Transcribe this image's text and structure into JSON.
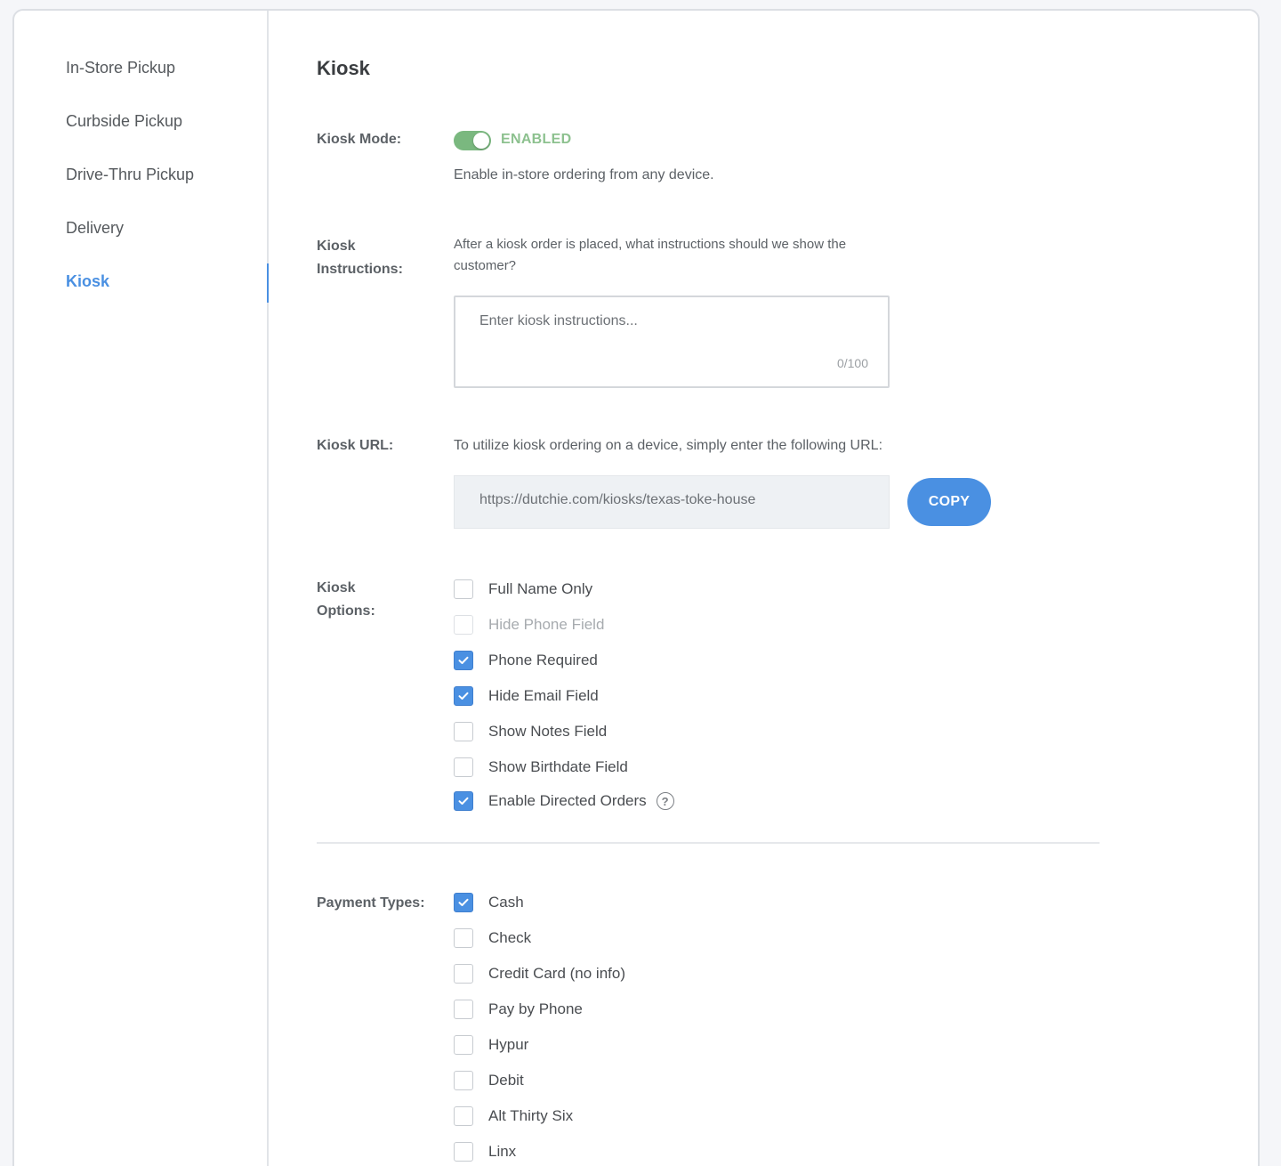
{
  "sidebar": {
    "items": [
      {
        "label": "In-Store Pickup"
      },
      {
        "label": "Curbside Pickup"
      },
      {
        "label": "Drive-Thru Pickup"
      },
      {
        "label": "Delivery"
      },
      {
        "label": "Kiosk",
        "active": true
      }
    ]
  },
  "page": {
    "title": "Kiosk"
  },
  "kiosk_mode": {
    "label": "Kiosk Mode:",
    "status": "ENABLED",
    "enabled": true,
    "description": "Enable in-store ordering from any device."
  },
  "kiosk_instructions": {
    "label_line1": "Kiosk",
    "label_line2": "Instructions:",
    "help": "After a kiosk order is placed, what instructions should we show the customer?",
    "placeholder": "Enter kiosk instructions...",
    "value": "",
    "char_count": "0/100"
  },
  "kiosk_url": {
    "label": "Kiosk URL:",
    "help": "To utilize kiosk ordering on a device, simply enter the following URL:",
    "url": "https://dutchie.com/kiosks/texas-toke-house",
    "copy_label": "COPY"
  },
  "kiosk_options": {
    "label_line1": "Kiosk",
    "label_line2": "Options:",
    "options": [
      {
        "label": "Full Name Only",
        "checked": false,
        "disabled": false
      },
      {
        "label": "Hide Phone Field",
        "checked": false,
        "disabled": true
      },
      {
        "label": "Phone Required",
        "checked": true,
        "disabled": false
      },
      {
        "label": "Hide Email Field",
        "checked": true,
        "disabled": false
      },
      {
        "label": "Show Notes Field",
        "checked": false,
        "disabled": false
      },
      {
        "label": "Show Birthdate Field",
        "checked": false,
        "disabled": false
      },
      {
        "label": "Enable Directed Orders",
        "checked": true,
        "disabled": false,
        "help_icon": "?"
      }
    ]
  },
  "payment_types": {
    "label": "Payment Types:",
    "options": [
      {
        "label": "Cash",
        "checked": true
      },
      {
        "label": "Check",
        "checked": false
      },
      {
        "label": "Credit Card (no info)",
        "checked": false
      },
      {
        "label": "Pay by Phone",
        "checked": false
      },
      {
        "label": "Hypur",
        "checked": false
      },
      {
        "label": "Debit",
        "checked": false
      },
      {
        "label": "Alt Thirty Six",
        "checked": false
      },
      {
        "label": "Linx",
        "checked": false
      }
    ]
  },
  "colors": {
    "accent": "#4a90e2",
    "toggle_on": "#7ab87f",
    "enabled_text": "#8dc18f"
  }
}
